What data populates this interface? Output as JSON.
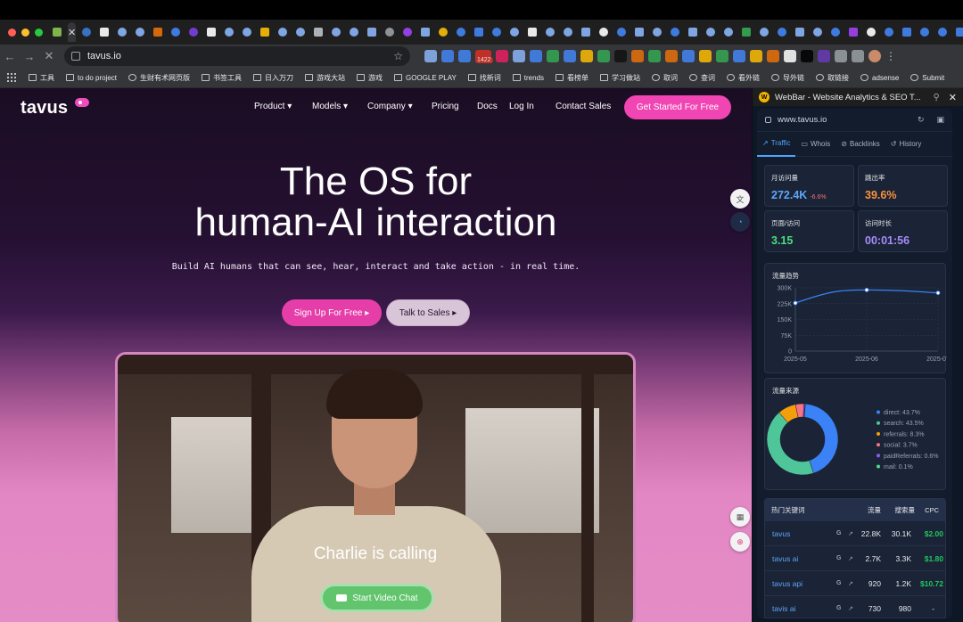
{
  "browser": {
    "tab_active_close": "✕",
    "new_tab": "+",
    "url": "tavus.io",
    "bookmarks": [
      {
        "label": "工具",
        "icon": "folder-icon"
      },
      {
        "label": "to do project",
        "icon": "folder-icon"
      },
      {
        "label": "生财有术网页版",
        "icon": "site-icon"
      },
      {
        "label": "书签工具",
        "icon": "folder-icon"
      },
      {
        "label": "日入万刀",
        "icon": "folder-icon"
      },
      {
        "label": "游戏大站",
        "icon": "folder-icon"
      },
      {
        "label": "游戏",
        "icon": "folder-icon"
      },
      {
        "label": "GOOGLE PLAY",
        "icon": "folder-icon"
      },
      {
        "label": "找新词",
        "icon": "folder-icon"
      },
      {
        "label": "trends",
        "icon": "folder-icon"
      },
      {
        "label": "看榜单",
        "icon": "folder-icon"
      },
      {
        "label": "学习做站",
        "icon": "folder-icon"
      },
      {
        "label": "取词",
        "icon": "globe-icon"
      },
      {
        "label": "查词",
        "icon": "globe-icon"
      },
      {
        "label": "看外链",
        "icon": "globe-icon"
      },
      {
        "label": "导外链",
        "icon": "globe-icon"
      },
      {
        "label": "取链接",
        "icon": "globe-icon"
      },
      {
        "label": "adsense",
        "icon": "globe-icon"
      },
      {
        "label": "Submit",
        "icon": "globe-icon"
      }
    ],
    "ext_badge": "1422",
    "ext_badge2": "2"
  },
  "site": {
    "logo": "tavus",
    "nav": [
      {
        "label": "Product ▾"
      },
      {
        "label": "Models ▾"
      },
      {
        "label": "Company ▾"
      },
      {
        "label": "Pricing"
      },
      {
        "label": "Docs"
      },
      {
        "label": "Log In"
      },
      {
        "label": "Contact Sales"
      }
    ],
    "cta": "Get Started For Free",
    "hero_line1": "The OS for",
    "hero_line2": "human-AI interaction",
    "hero_sub": "Build AI humans that can see, hear, interact and take action - in real time.",
    "signup": "Sign Up For Free ▸",
    "talk": "Talk to Sales ▸",
    "calling": "Charlie is calling",
    "video_btn": "Start Video Chat"
  },
  "panel": {
    "title": "WebBar - Website Analytics & SEO T...",
    "domain": "www.tavus.io",
    "tabs": [
      {
        "label": "Traffic",
        "icon": "trend-icon",
        "glyph": "↗"
      },
      {
        "label": "Whois",
        "icon": "id-card-icon",
        "glyph": "▭"
      },
      {
        "label": "Backlinks",
        "icon": "link-icon",
        "glyph": "⊘"
      },
      {
        "label": "History",
        "icon": "history-icon",
        "glyph": "↺"
      }
    ],
    "stats": [
      {
        "label": "月访问量",
        "value": "272.4K",
        "change": "-6.6%",
        "color": "#60a5fa"
      },
      {
        "label": "跳出率",
        "value": "39.6%",
        "change": "",
        "color": "#fb923c"
      },
      {
        "label": "页面/访问",
        "value": "3.15",
        "change": "",
        "color": "#4ade80"
      },
      {
        "label": "访问时长",
        "value": "00:01:56",
        "change": "",
        "color": "#a78bfa"
      }
    ],
    "trend_title": "流量趋势",
    "source_title": "流量来源",
    "kw_title": "热门关键词",
    "kw_cols": {
      "traffic": "流量",
      "volume": "搜索量",
      "cpc": "CPC"
    },
    "keywords": [
      {
        "kw": "tavus",
        "g": "G",
        "t": "22.8K",
        "s": "30.1K",
        "c": "$2.00"
      },
      {
        "kw": "tavus ai",
        "g": "G",
        "t": "2.7K",
        "s": "3.3K",
        "c": "$1.80"
      },
      {
        "kw": "tavus api",
        "g": "G",
        "t": "920",
        "s": "1.2K",
        "c": "$10.72"
      },
      {
        "kw": "tavis ai",
        "g": "G",
        "t": "730",
        "s": "980",
        "c": "-"
      }
    ]
  },
  "chart_data": [
    {
      "type": "line",
      "title": "流量趋势",
      "x": [
        "2025-05",
        "2025-06",
        "2025-07"
      ],
      "series": [
        {
          "values": [
            228000,
            290000,
            276000
          ]
        }
      ],
      "yticks": [
        "300K",
        "225K",
        "150K",
        "75K",
        "0"
      ],
      "ylim": [
        0,
        300000
      ],
      "grid": true,
      "color": "#3b82f6"
    },
    {
      "type": "pie",
      "title": "流量来源",
      "categories": [
        "direct",
        "search",
        "referrals",
        "social",
        "paidReferrals",
        "mail"
      ],
      "values": [
        43.7,
        43.5,
        8.3,
        3.7,
        0.6,
        0.1
      ],
      "labels": [
        "direct: 43.7%",
        "search: 43.5%",
        "referrals: 8.3%",
        "social: 3.7%",
        "paidReferrals: 0.6%",
        "mail: 0.1%"
      ],
      "colors": [
        "#3b82f6",
        "#4fc69a",
        "#f59e0b",
        "#fb7185",
        "#8b5cf6",
        "#4ade80"
      ],
      "legend": "right"
    }
  ]
}
